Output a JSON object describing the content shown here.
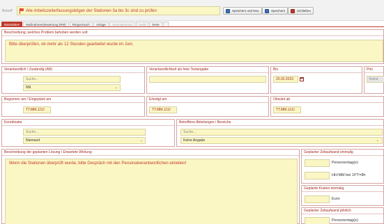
{
  "header": {
    "betreff_label": "Betreff",
    "betreff_value": "Alle Arbeitszeiterfassungsbögen der Stationen 3a bis 3c sind zu prüfen",
    "buttons": {
      "save_new": "Speichern und Neu",
      "save": "Speichern",
      "close": "Schließen"
    }
  },
  "tabs": [
    "Basisdaten",
    "Maßnahmenbewertung (RM)",
    "Ringversuch",
    "Anlage",
    "Verantwortung",
    "Audit",
    "Serie"
  ],
  "problem": {
    "label": "Beschreibung, welches Problem behoben werden soll:",
    "value": "Bitte überprüfen, ob mehr als 12 Stunden gearbeitet wurde im Juni."
  },
  "responsible": {
    "label": "Verantwortlich / Zuständig (AN)",
    "search_placeholder": "Suche...",
    "selected": "NN"
  },
  "free_text": {
    "label": "Verantwortlichkeit als freie Textangabe",
    "value": ""
  },
  "bis": {
    "label": "Bis",
    "value": "20.02.2023"
  },
  "prio": {
    "label": "Prio",
    "selected": "Keine"
  },
  "begonnen": {
    "label": "Begonnen am / Eingeplant am",
    "placeholder": "TT.MM.JJJJ"
  },
  "erledigt": {
    "label": "Erledigt am",
    "placeholder": "TT.MM.JJJJ"
  },
  "obsolet": {
    "label": "Obsolet ab",
    "placeholder": "TT.MM.JJJJ"
  },
  "koordinator": {
    "label": "Koordinator",
    "search_placeholder": "Suche...",
    "selected": "Niemand"
  },
  "abteilungen": {
    "label": "Betroffene Abteilungen / Bereiche",
    "search_placeholder": "Suche...",
    "selected": "Keine Angabe"
  },
  "loesung": {
    "label": "Beschreibung der geplanten Lösung / Erwartete Wirkung",
    "value": "Wenn die Stationen überprüft wurde, bitte Gespräch mit den Personalverantwortlichen einleiten!"
  },
  "zeitaufwand": {
    "label": "Geplanter Zeitaufwand einmalig",
    "unit1": "Personentag(e)",
    "unit2": "HH:MM bei 1PT=8h"
  },
  "kosten": {
    "label": "Geplante Kosten einmalig",
    "unit": "Euro"
  },
  "zeitaufwand_jaehrlich": {
    "label": "Geplanter Zeitaufwand jährlich",
    "unit": "Personentag(e)"
  },
  "colors": {
    "accent": "#c0392b",
    "field_bg": "#fbf7c4"
  }
}
